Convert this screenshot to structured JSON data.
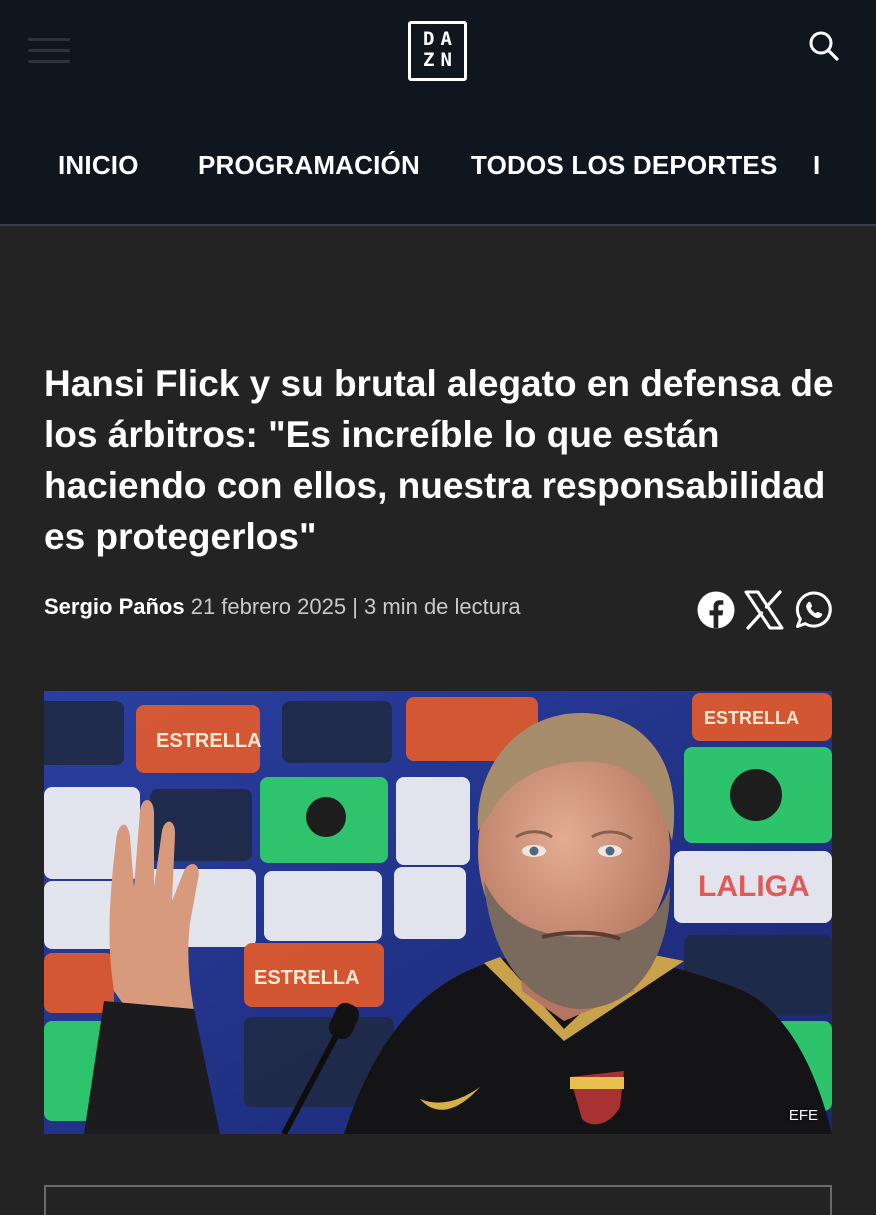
{
  "header": {
    "menu_icon": "hamburger-menu-icon",
    "logo": {
      "line1": "DA",
      "line2": "ZN"
    },
    "search_icon": "search-icon",
    "background": "#0f161e"
  },
  "nav": {
    "items": [
      {
        "label": "INICIO"
      },
      {
        "label": "PROGRAMACIÓN"
      },
      {
        "label": "TODOS LOS DEPORTES"
      },
      {
        "label": "I"
      }
    ]
  },
  "article": {
    "headline": "Hansi Flick y su brutal alegato en defensa de los árbitros: \"Es increíble lo que están haciendo con ellos, nuestra responsabilidad es protegerlos\"",
    "author": "Sergio Paños",
    "date": "21 febrero 2025",
    "separator": "|",
    "read_time": "3 min de lectura",
    "share": [
      "facebook-icon",
      "x-icon",
      "whatsapp-icon"
    ],
    "image": {
      "credit": "EFE",
      "board_text": [
        "ESTRELLA",
        "LALIGA"
      ]
    }
  },
  "colors": {
    "page_background": "#232323",
    "text_primary": "#ffffff",
    "text_secondary": "#c9c9c9"
  }
}
